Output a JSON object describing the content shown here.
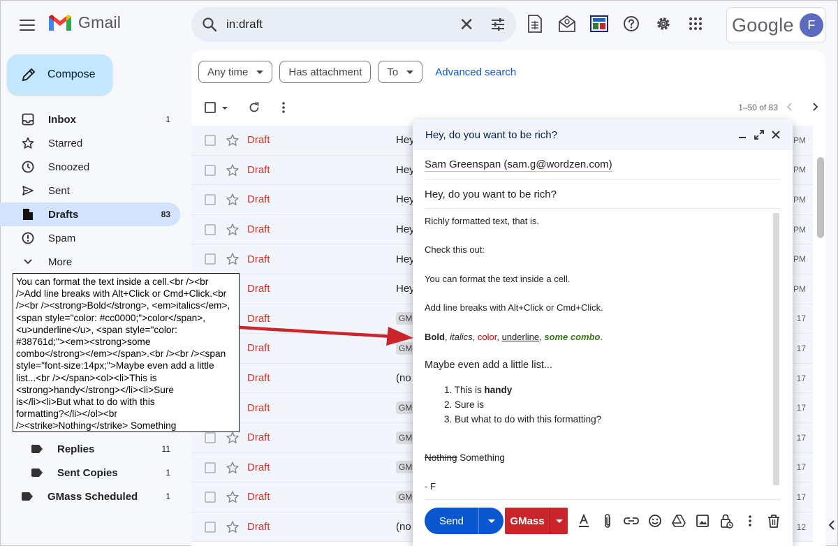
{
  "header": {
    "app_name": "Gmail",
    "search_value": "in:draft",
    "google_text": "Google",
    "avatar_letter": "F"
  },
  "sidebar": {
    "compose_label": "Compose",
    "items": [
      {
        "label": "Inbox",
        "count": "1",
        "icon": "inbox-icon"
      },
      {
        "label": "Starred",
        "count": "",
        "icon": "star-icon"
      },
      {
        "label": "Snoozed",
        "count": "",
        "icon": "clock-icon"
      },
      {
        "label": "Sent",
        "count": "",
        "icon": "send-icon"
      },
      {
        "label": "Drafts",
        "count": "83",
        "icon": "draft-icon"
      },
      {
        "label": "Spam",
        "count": "",
        "icon": "spam-icon"
      },
      {
        "label": "More",
        "count": "",
        "icon": "chevron-down-icon"
      }
    ],
    "labels": [
      {
        "label": "Replies",
        "count": "11"
      },
      {
        "label": "Sent Copies",
        "count": "1"
      },
      {
        "label": "GMass Scheduled",
        "count": "1"
      }
    ]
  },
  "filters": {
    "any_time": "Any time",
    "has_attachment": "Has attachment",
    "to": "To",
    "advanced": "Advanced search"
  },
  "list": {
    "pager": "1–50 of 83",
    "rows": [
      {
        "label": "Draft",
        "subject": "Hey",
        "tag": "",
        "date": "PM"
      },
      {
        "label": "Draft",
        "subject": "Hey",
        "tag": "",
        "date": "PM"
      },
      {
        "label": "Draft",
        "subject": "Hey",
        "tag": "",
        "date": "PM"
      },
      {
        "label": "Draft",
        "subject": "Hey",
        "tag": "",
        "date": "PM"
      },
      {
        "label": "Draft",
        "subject": "Hey",
        "tag": "",
        "date": "PM"
      },
      {
        "label": "Draft",
        "subject": "Hey",
        "tag": "",
        "date": "PM"
      },
      {
        "label": "Draft",
        "subject": "",
        "tag": "GM",
        "date": "17"
      },
      {
        "label": "Draft",
        "subject": "",
        "tag": "GM",
        "date": "17"
      },
      {
        "label": "Draft",
        "subject": "(no",
        "tag": "",
        "date": "17"
      },
      {
        "label": "Draft",
        "subject": "",
        "tag": "GM",
        "date": "17"
      },
      {
        "label": "Draft",
        "subject": "",
        "tag": "GM",
        "date": "17"
      },
      {
        "label": "Draft",
        "subject": "",
        "tag": "GM",
        "date": "17"
      },
      {
        "label": "Draft",
        "subject": "",
        "tag": "GM",
        "date": "17"
      },
      {
        "label": "Draft",
        "subject": "(no",
        "tag": "",
        "date": "12"
      }
    ]
  },
  "compose": {
    "title": "Hey, do you want to be rich?",
    "to": "Sam Greenspan (sam.g@wordzen.com)",
    "subject": "Hey, do you want to be rich?",
    "line1": "Richly formatted text, that is.",
    "line2": "Check this out:",
    "line3": "You can format the text inside a cell.",
    "line4": "Add line breaks with Alt+Click or Cmd+Click.",
    "fmt_bold": "Bold",
    "fmt_sep1": ", ",
    "fmt_italics": "italics",
    "fmt_sep2": ", ",
    "fmt_color": "color",
    "fmt_sep3": ", ",
    "fmt_underline": "underline",
    "fmt_sep4": ", ",
    "fmt_combo": "some combo",
    "fmt_end": ".",
    "list_intro": "Maybe even add a little list...",
    "li1_num": "1.",
    "li1_text": "This is ",
    "li1_bold": "handy",
    "li2_num": "2.",
    "li2_text": "Sure is",
    "li3_num": "3.",
    "li3_text": "But what to do with this formatting?",
    "strike": "Nothing",
    "after_strike": " Something",
    "signature": "- F",
    "send_label": "Send",
    "gmass_label": "GMass"
  },
  "code_tooltip": {
    "lines": [
      "You can format the text inside a cell.<br /><br",
      "/>Add line breaks with Alt+Click or Cmd+Click.<br",
      "/><br /><strong>Bold</strong>, <em>italics</em>,",
      "<span style=\"color: #cc0000;\">color</span>,",
      "<u>underline</u>, <span style=\"color:",
      "#38761d;\"><em><strong>some",
      "combo</strong></em></span>.<br /><br /><span",
      "style=\"font-size:14px;\">Maybe even add a little",
      "list...<br /></span><ol><li>This is",
      "<strong>handy</strong></li><li>Sure",
      "is</li><li>But what to do with this",
      "formatting?</li></ol><br",
      "/><strike>Nothing</strike> Something"
    ]
  },
  "colors": {
    "red_text": "#cc0000",
    "green_text": "#38761d",
    "send_blue": "#0b57d0",
    "gmass_red": "#c9252b",
    "arrow_red": "#c9252b"
  }
}
